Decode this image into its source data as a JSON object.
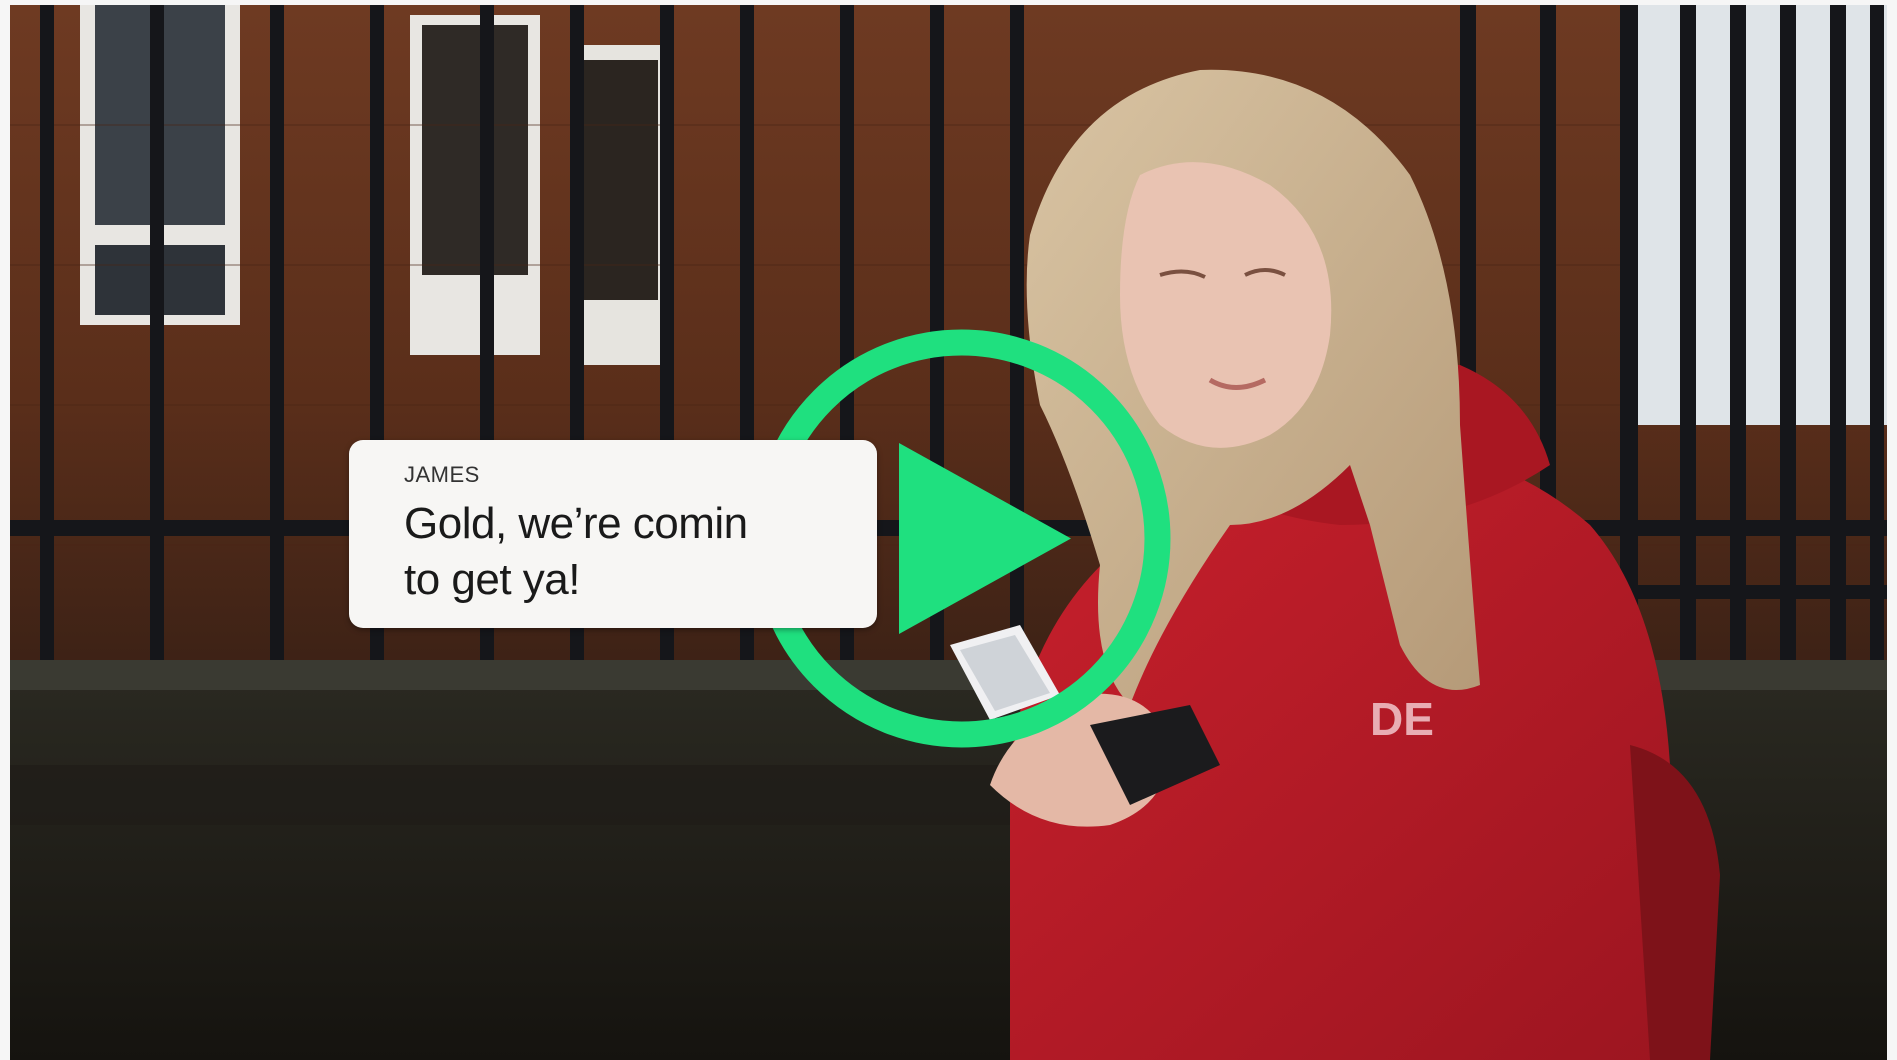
{
  "video": {
    "description_icon": "video-thumbnail",
    "play_icon": "play-circle-icon",
    "play_color": "#1FE07F"
  },
  "chat": {
    "sender": "JAMES",
    "message_line1": "Gold, we’re comin",
    "message_line2": "to get ya!"
  }
}
